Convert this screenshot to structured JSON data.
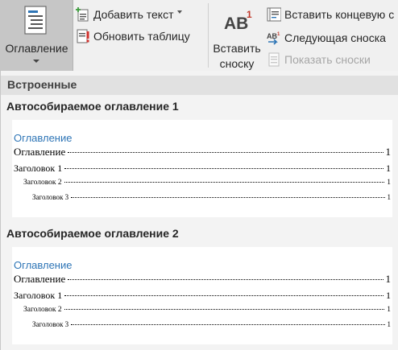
{
  "ribbon": {
    "toc_button": {
      "label": "Оглавление"
    },
    "add_text": {
      "label": "Добавить текст"
    },
    "update_table": {
      "label": "Обновить таблицу"
    },
    "insert_footnote": {
      "label_line1": "Вставить",
      "label_line2": "сноску",
      "icon_text": "AB",
      "icon_sup": "1"
    },
    "insert_endnote": {
      "label": "Вставить концевую с"
    },
    "next_footnote": {
      "label": "Следующая сноска"
    },
    "show_notes": {
      "label": "Показать сноски",
      "disabled": true
    }
  },
  "gallery": {
    "section_header": "Встроенные",
    "items": [
      {
        "title": "Автособираемое оглавление 1",
        "preview": {
          "heading": "Оглавление",
          "entries": [
            {
              "text": "Оглавление",
              "page": "1"
            },
            {
              "text": "Заголовок 1",
              "page": "1"
            },
            {
              "text": "Заголовок 2",
              "page": "1"
            },
            {
              "text": "Заголовок 3",
              "page": "1"
            }
          ]
        }
      },
      {
        "title": "Автособираемое оглавление 2",
        "preview": {
          "heading": "Оглавление",
          "entries": [
            {
              "text": "Оглавление",
              "page": "1"
            },
            {
              "text": "Заголовок 1",
              "page": "1"
            },
            {
              "text": "Заголовок 2",
              "page": "1"
            },
            {
              "text": "Заголовок 3",
              "page": "1"
            }
          ]
        }
      }
    ]
  },
  "colors": {
    "toc_heading_blue": "#2e75b6",
    "footnote_red": "#c0392b",
    "ribbon_bg": "#f0f0f0",
    "selected_button_bg": "#c6c6c6"
  }
}
